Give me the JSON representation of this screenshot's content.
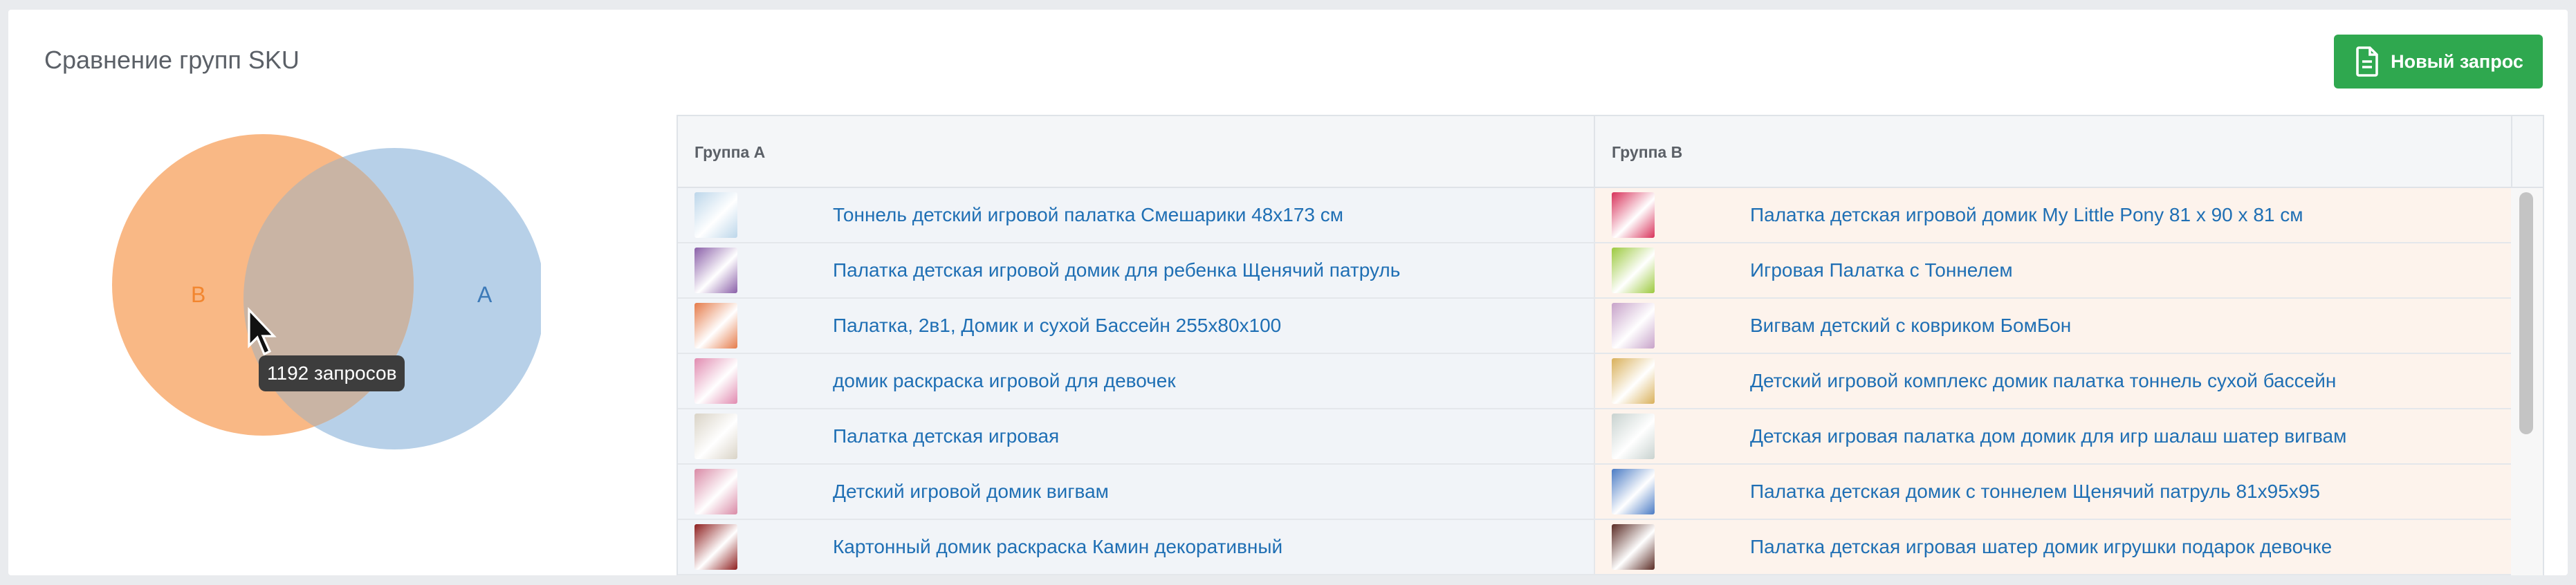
{
  "panel": {
    "title": "Сравнение групп SKU",
    "new_request_label": "Новый запрос"
  },
  "venn": {
    "label_a": "A",
    "label_b": "B",
    "tooltip": "1192 запросов",
    "colors": {
      "a": "#b7d0e8",
      "b": "#f9b885",
      "overlap": "#c9b4a4",
      "label_a": "#3d7ab8",
      "label_b": "#f2862f"
    }
  },
  "table": {
    "header_a": "Группа A",
    "header_b": "Группа B",
    "rows": [
      {
        "a": "Тоннель детский игровой палатка Смешарики 48х173 см",
        "b": "Палатка детская игровой домик My Little Pony 81 х 90 х 81 см",
        "thumb_a": "#bcd6ea",
        "thumb_b": "#d8325a"
      },
      {
        "a": "Палатка детская игровой домик для ребенка Щенячий патруль",
        "b": "Игровая Палатка с Тоннелем",
        "thumb_a": "#8a5fa8",
        "thumb_b": "#9cc93e"
      },
      {
        "a": "Палатка, 2в1, Домик и сухой Бассейн 255x80x100",
        "b": "Вигвам детский с ковриком БомБон",
        "thumb_a": "#e57b4a",
        "thumb_b": "#c7a2c9"
      },
      {
        "a": "домик раскраска игровой для девочек",
        "b": "Детский игровой комплекс домик палатка тоннель сухой бассейн",
        "thumb_a": "#e18bb0",
        "thumb_b": "#d9b05a"
      },
      {
        "a": "Палатка детская игровая",
        "b": "Детская игровая палатка дом домик для игр шалаш шатер вигвам",
        "thumb_a": "#d9d3c6",
        "thumb_b": "#c8d2cf"
      },
      {
        "a": "Детский игровой домик вигвам",
        "b": "Палатка детская домик с тоннелем Щенячий патруль 81х95х95",
        "thumb_a": "#d98aa6",
        "thumb_b": "#4a7bc4"
      },
      {
        "a": "Картонный домик раскраска Камин декоративный",
        "b": "Палатка детская игровая шатер домик игрушки подарок девочке",
        "thumb_a": "#8e1f1f",
        "thumb_b": "#5a2b24"
      }
    ]
  }
}
